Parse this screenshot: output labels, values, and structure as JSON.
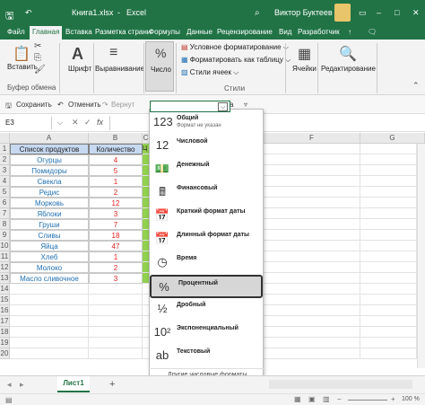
{
  "title": {
    "filename": "Книга1.xlsx",
    "separator": "-",
    "app": "Excel",
    "user": "Виктор Буктеев"
  },
  "menu": [
    "Файл",
    "Главная",
    "Вставка",
    "Разметка страни",
    "Формулы",
    "Данные",
    "Рецензирование",
    "Вид",
    "Разработчик"
  ],
  "ribbon": {
    "paste": "Вставить",
    "font": "Шрифт",
    "align": "Выравнивание",
    "number": "Число",
    "number_icon": "%",
    "cond_format": "Условное форматирование",
    "table_format": "Форматировать как таблицу",
    "cell_styles": "Стили ячеек",
    "cells": "Ячейки",
    "editing": "Редактирование",
    "clipboard": "Буфер обмена",
    "styles": "Стили"
  },
  "qat": {
    "save": "Сохранить",
    "undo": "Отменить",
    "redo": "Вернут"
  },
  "formula": {
    "cell_ref": "E3",
    "fx": "fx"
  },
  "grid": {
    "cols": [
      "A",
      "B",
      "C"
    ],
    "right_cols": [
      "F",
      "G"
    ],
    "rows": [
      "1",
      "2",
      "3",
      "4",
      "5",
      "6",
      "7",
      "8",
      "9",
      "10",
      "11",
      "12",
      "13",
      "14",
      "15",
      "16",
      "17",
      "18",
      "19",
      "20"
    ],
    "header_a": "Список продуктов",
    "header_b": "Количество",
    "header_c": "Ц",
    "products": [
      "Огурцы",
      "Помидоры",
      "Свекла",
      "Редис",
      "Морковь",
      "Яблоки",
      "Груши",
      "Сливы",
      "Яйца",
      "Хлеб",
      "Молоко",
      "Масло сливочное"
    ],
    "quantities": [
      "4",
      "5",
      "1",
      "2",
      "12",
      "3",
      "7",
      "18",
      "47",
      "1",
      "2",
      "3"
    ]
  },
  "dropdown": {
    "items": [
      {
        "label": "Общий",
        "sub": "Формат не указан",
        "icon": "123"
      },
      {
        "label": "Числовой",
        "sub": "",
        "icon": "12"
      },
      {
        "label": "Денежный",
        "sub": "",
        "icon": "money-icon"
      },
      {
        "label": "Финансовый",
        "sub": "",
        "icon": "calculator-icon"
      },
      {
        "label": "Краткий формат даты",
        "sub": "",
        "icon": "calendar-icon"
      },
      {
        "label": "Длинный формат даты",
        "sub": "",
        "icon": "calendar-icon"
      },
      {
        "label": "Время",
        "sub": "",
        "icon": "clock-icon"
      },
      {
        "label": "Процентный",
        "sub": "",
        "icon": "%"
      },
      {
        "label": "Дробный",
        "sub": "",
        "icon": "½"
      },
      {
        "label": "Экспоненциальный",
        "sub": "",
        "icon": "10²"
      },
      {
        "label": "Текстовый",
        "sub": "",
        "icon": "ab"
      }
    ],
    "more": "Другие числовые форматы..."
  },
  "sheet": {
    "tab": "Лист1",
    "add": "+"
  },
  "status": {
    "zoom": "100 %"
  },
  "colors": {
    "excel_green": "#217346",
    "header_fill": "#c6d9f1",
    "product_text": "#1f6fb2",
    "qty_text": "#e02020",
    "c_column": "#92d050"
  }
}
